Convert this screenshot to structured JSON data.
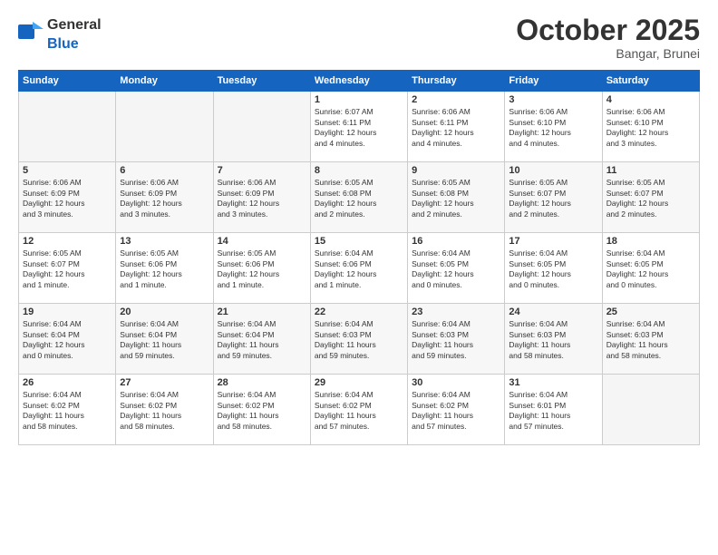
{
  "header": {
    "logo_general": "General",
    "logo_blue": "Blue",
    "month": "October 2025",
    "location": "Bangar, Brunei"
  },
  "days_of_week": [
    "Sunday",
    "Monday",
    "Tuesday",
    "Wednesday",
    "Thursday",
    "Friday",
    "Saturday"
  ],
  "weeks": [
    [
      {
        "day": "",
        "info": ""
      },
      {
        "day": "",
        "info": ""
      },
      {
        "day": "",
        "info": ""
      },
      {
        "day": "1",
        "info": "Sunrise: 6:07 AM\nSunset: 6:11 PM\nDaylight: 12 hours\nand 4 minutes."
      },
      {
        "day": "2",
        "info": "Sunrise: 6:06 AM\nSunset: 6:11 PM\nDaylight: 12 hours\nand 4 minutes."
      },
      {
        "day": "3",
        "info": "Sunrise: 6:06 AM\nSunset: 6:10 PM\nDaylight: 12 hours\nand 4 minutes."
      },
      {
        "day": "4",
        "info": "Sunrise: 6:06 AM\nSunset: 6:10 PM\nDaylight: 12 hours\nand 3 minutes."
      }
    ],
    [
      {
        "day": "5",
        "info": "Sunrise: 6:06 AM\nSunset: 6:09 PM\nDaylight: 12 hours\nand 3 minutes."
      },
      {
        "day": "6",
        "info": "Sunrise: 6:06 AM\nSunset: 6:09 PM\nDaylight: 12 hours\nand 3 minutes."
      },
      {
        "day": "7",
        "info": "Sunrise: 6:06 AM\nSunset: 6:09 PM\nDaylight: 12 hours\nand 3 minutes."
      },
      {
        "day": "8",
        "info": "Sunrise: 6:05 AM\nSunset: 6:08 PM\nDaylight: 12 hours\nand 2 minutes."
      },
      {
        "day": "9",
        "info": "Sunrise: 6:05 AM\nSunset: 6:08 PM\nDaylight: 12 hours\nand 2 minutes."
      },
      {
        "day": "10",
        "info": "Sunrise: 6:05 AM\nSunset: 6:07 PM\nDaylight: 12 hours\nand 2 minutes."
      },
      {
        "day": "11",
        "info": "Sunrise: 6:05 AM\nSunset: 6:07 PM\nDaylight: 12 hours\nand 2 minutes."
      }
    ],
    [
      {
        "day": "12",
        "info": "Sunrise: 6:05 AM\nSunset: 6:07 PM\nDaylight: 12 hours\nand 1 minute."
      },
      {
        "day": "13",
        "info": "Sunrise: 6:05 AM\nSunset: 6:06 PM\nDaylight: 12 hours\nand 1 minute."
      },
      {
        "day": "14",
        "info": "Sunrise: 6:05 AM\nSunset: 6:06 PM\nDaylight: 12 hours\nand 1 minute."
      },
      {
        "day": "15",
        "info": "Sunrise: 6:04 AM\nSunset: 6:06 PM\nDaylight: 12 hours\nand 1 minute."
      },
      {
        "day": "16",
        "info": "Sunrise: 6:04 AM\nSunset: 6:05 PM\nDaylight: 12 hours\nand 0 minutes."
      },
      {
        "day": "17",
        "info": "Sunrise: 6:04 AM\nSunset: 6:05 PM\nDaylight: 12 hours\nand 0 minutes."
      },
      {
        "day": "18",
        "info": "Sunrise: 6:04 AM\nSunset: 6:05 PM\nDaylight: 12 hours\nand 0 minutes."
      }
    ],
    [
      {
        "day": "19",
        "info": "Sunrise: 6:04 AM\nSunset: 6:04 PM\nDaylight: 12 hours\nand 0 minutes."
      },
      {
        "day": "20",
        "info": "Sunrise: 6:04 AM\nSunset: 6:04 PM\nDaylight: 11 hours\nand 59 minutes."
      },
      {
        "day": "21",
        "info": "Sunrise: 6:04 AM\nSunset: 6:04 PM\nDaylight: 11 hours\nand 59 minutes."
      },
      {
        "day": "22",
        "info": "Sunrise: 6:04 AM\nSunset: 6:03 PM\nDaylight: 11 hours\nand 59 minutes."
      },
      {
        "day": "23",
        "info": "Sunrise: 6:04 AM\nSunset: 6:03 PM\nDaylight: 11 hours\nand 59 minutes."
      },
      {
        "day": "24",
        "info": "Sunrise: 6:04 AM\nSunset: 6:03 PM\nDaylight: 11 hours\nand 58 minutes."
      },
      {
        "day": "25",
        "info": "Sunrise: 6:04 AM\nSunset: 6:03 PM\nDaylight: 11 hours\nand 58 minutes."
      }
    ],
    [
      {
        "day": "26",
        "info": "Sunrise: 6:04 AM\nSunset: 6:02 PM\nDaylight: 11 hours\nand 58 minutes."
      },
      {
        "day": "27",
        "info": "Sunrise: 6:04 AM\nSunset: 6:02 PM\nDaylight: 11 hours\nand 58 minutes."
      },
      {
        "day": "28",
        "info": "Sunrise: 6:04 AM\nSunset: 6:02 PM\nDaylight: 11 hours\nand 58 minutes."
      },
      {
        "day": "29",
        "info": "Sunrise: 6:04 AM\nSunset: 6:02 PM\nDaylight: 11 hours\nand 57 minutes."
      },
      {
        "day": "30",
        "info": "Sunrise: 6:04 AM\nSunset: 6:02 PM\nDaylight: 11 hours\nand 57 minutes."
      },
      {
        "day": "31",
        "info": "Sunrise: 6:04 AM\nSunset: 6:01 PM\nDaylight: 11 hours\nand 57 minutes."
      },
      {
        "day": "",
        "info": ""
      }
    ]
  ]
}
